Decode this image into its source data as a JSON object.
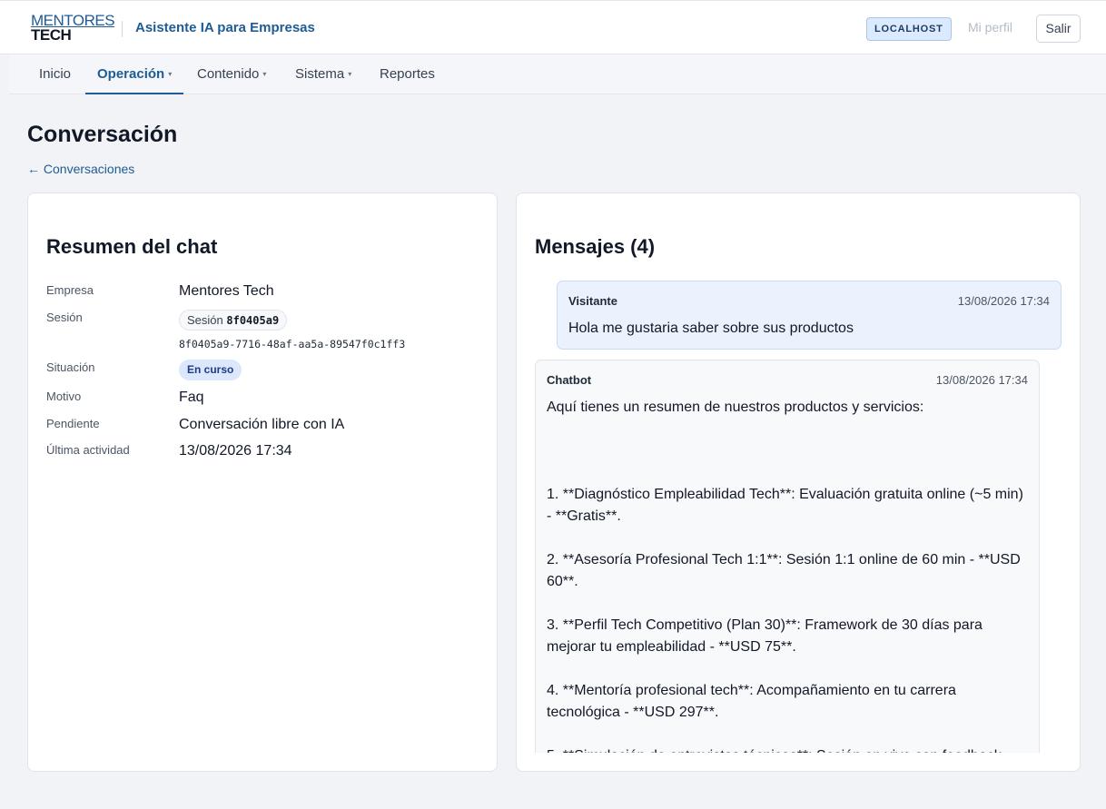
{
  "header": {
    "logo_line1": "MENTORES",
    "logo_line2": "TECH",
    "app_title": "Asistente IA para Empresas",
    "env_badge": "LOCALHOST",
    "profile_link": "Mi perfil",
    "logout_label": "Salir"
  },
  "nav": {
    "items": [
      {
        "label": "Inicio",
        "has_caret": false
      },
      {
        "label": "Operación",
        "has_caret": true,
        "active": true
      },
      {
        "label": "Contenido",
        "has_caret": true
      },
      {
        "label": "Sistema",
        "has_caret": true
      },
      {
        "label": "Reportes",
        "has_caret": false
      }
    ],
    "caret_glyph": "▾"
  },
  "page": {
    "title": "Conversación",
    "back_link": "← Conversaciones"
  },
  "summary": {
    "title": "Resumen del chat",
    "empresa_label": "Empresa",
    "empresa_value": "Mentores Tech",
    "sesion_label": "Sesión",
    "sesion_pill_prefix": "Sesión",
    "sesion_short": "8f0405a9",
    "sesion_full": "8f0405a9-7716-48af-aa5a-89547f0c1ff3",
    "situacion_label": "Situación",
    "situacion_value": "En curso",
    "motivo_label": "Motivo",
    "motivo_value": "Faq",
    "pendiente_label": "Pendiente",
    "pendiente_value": "Conversación libre con IA",
    "ultima_label": "Última actividad",
    "ultima_value": "13/08/2026 17:34"
  },
  "messages": {
    "title": "Mensajes (4)",
    "items": [
      {
        "sender": "Visitante",
        "time": "13/08/2026 17:34",
        "body": "Hola me gustaria saber sobre sus productos"
      },
      {
        "sender": "Chatbot",
        "time": "13/08/2026 17:34",
        "body": "Aquí tienes un resumen de nuestros productos y servicios:\n\n\n\n1. **Diagnóstico Empleabilidad Tech**: Evaluación gratuita online (~5 min) - **Gratis**.\n\n2. **Asesoría Profesional Tech 1:1**: Sesión 1:1 online de 60 min - **USD 60**.\n\n3. **Perfil Tech Competitivo (Plan 30)**: Framework de 30 días para mejorar tu empleabilidad - **USD 75**.\n\n4. **Mentoría profesional tech**: Acompañamiento en tu carrera tecnológica - **USD 297**.\n\n5. **Simulación de entrevistas técnicas**: Sesión en vivo con feedback"
      }
    ]
  }
}
